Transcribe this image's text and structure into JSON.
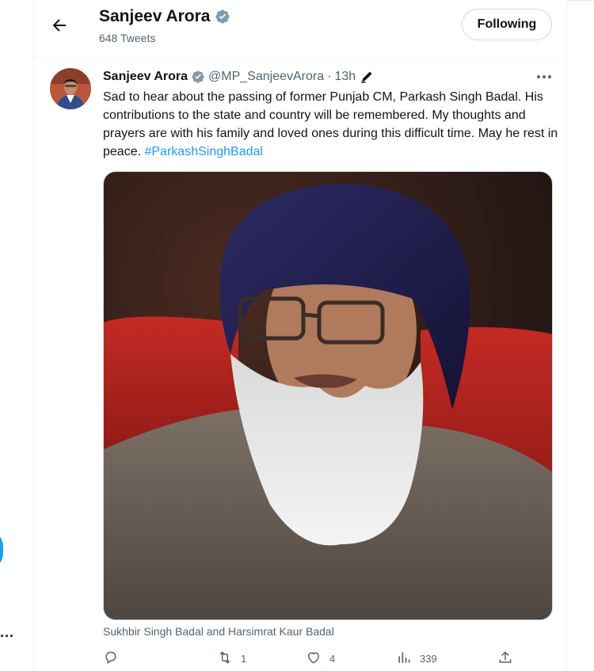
{
  "header": {
    "title": "Sanjeev Arora",
    "subtitle": "648 Tweets",
    "follow_label": "Following"
  },
  "tweet": {
    "author_name": "Sanjeev Arora",
    "handle": "@MP_SanjeevArora",
    "separator": "·",
    "time": "13h",
    "text": "Sad to hear about the passing of former Punjab CM, Parkash Singh Badal. His contributions to the state and country will be remembered. My thoughts and prayers are with his family and loved ones during this difficult time. May he rest in peace.",
    "hashtag": "#ParkashSinghBadal",
    "media_caption": "Sukhbir Singh Badal and Harsimrat Kaur Badal"
  },
  "actions": {
    "reply_count": "",
    "retweet_count": "1",
    "like_count": "4",
    "views_count": "339"
  },
  "left_rail": {
    "more_label": "..."
  },
  "colors": {
    "accent": "#1d9bf0",
    "text": "#0f1419",
    "muted": "#536471",
    "border": "#eff3f4"
  }
}
